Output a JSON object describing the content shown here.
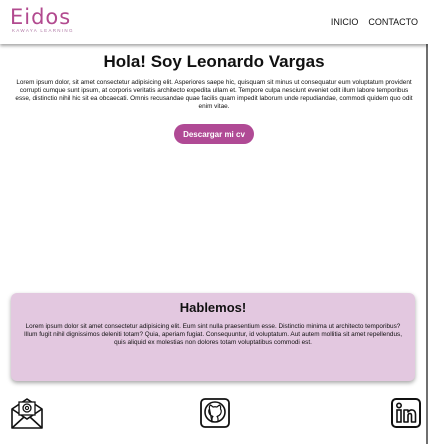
{
  "header": {
    "logo_text": "Eidos",
    "logo_tagline": "KAWAYA LEARNING",
    "nav": [
      {
        "label": "INICIO"
      },
      {
        "label": "CONTACTO"
      }
    ]
  },
  "hero": {
    "title": "Hola! Soy Leonardo Vargas",
    "body": "Lorem ipsum dolor, sit amet consectetur adipisicing elit. Asperiores saepe hic, quisquam sit minus ut consequatur eum voluptatum provident corrupti cumque sunt ipsum, at corporis veritatis architecto expedita ullam et. Tempore culpa nesciunt eveniet odit illum labore temporibus esse, distinctio nihil hic sit ea obcaecati. Omnis recusandae quae facilis quam impedit laborum unde repudiandae, commodi quidem quo odit enim vitae.",
    "cv_button": "Descargar mi cv"
  },
  "contact": {
    "title": "Hablemos!",
    "body": "Lorem ipsum dolor sit amet consectetur adipisicing elit. Eum sint nulla praesentium esse. Distinctio minima ut architecto temporibus? Illum fugit nihil dignissimos deleniti totam? Quia, aperiam fugiat. Consequuntur, id voluptatum. Aut autem mollitia sit amet repellendus, quis aliquid ex molestias non dolores totam voluptatibus commodi est."
  },
  "footer": {
    "icons": [
      "email-icon",
      "github-icon",
      "linkedin-icon"
    ]
  },
  "colors": {
    "brand": "#b24a8f",
    "button": "#b04a95",
    "card_bg": "#e3c8e0"
  }
}
